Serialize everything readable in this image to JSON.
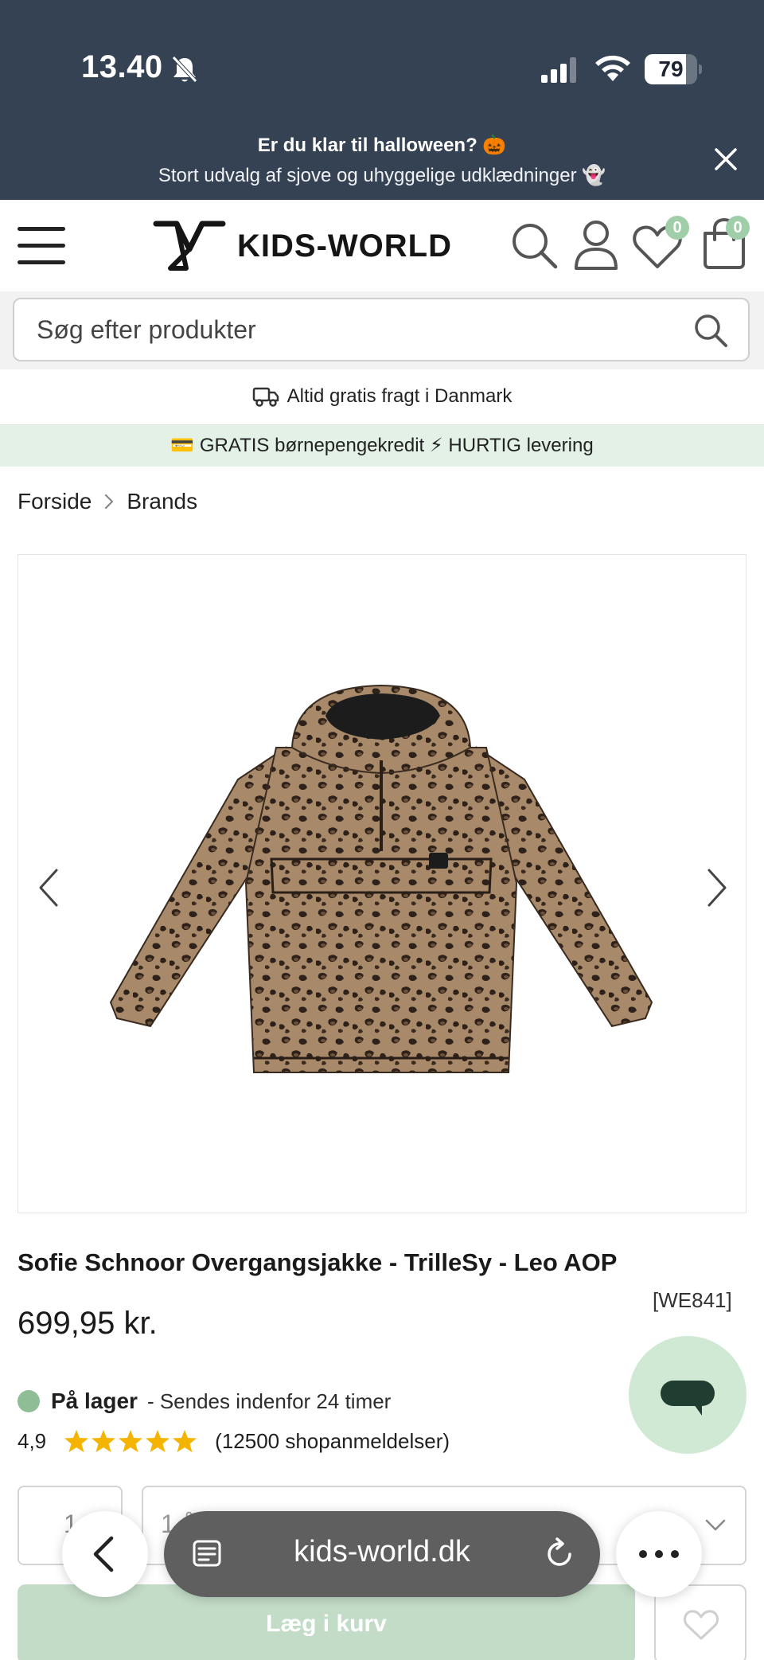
{
  "status_bar": {
    "time": "13.40",
    "battery": "79",
    "battery_level": 0.79
  },
  "announcement": {
    "title": "Er du klar til halloween? 🎃",
    "subtitle": "Stort udvalg af sjove og uhyggelige udklædninger 👻"
  },
  "header": {
    "logo_text": "KIDS-WORLD",
    "wishlist_count": "0",
    "cart_count": "0"
  },
  "search": {
    "placeholder": "Søg efter produkter"
  },
  "shipping_notice": "Altid gratis fragt i Danmark",
  "promo_bar": "💳 GRATIS børnepengekredit ⚡ HURTIG levering",
  "breadcrumb": [
    "Forside",
    "Brands"
  ],
  "product": {
    "title": "Sofie Schnoor Overgangsjakke - TrilleSy - Leo AOP",
    "sku": "[WE841]",
    "price": "699,95 kr.",
    "stock_label": "På lager",
    "stock_note": "- Sendes indenfor 24 timer",
    "rating": "4,9",
    "stars": 5,
    "reviews": "(12500 shopanmeldelser)",
    "quantity": "1",
    "size": "1 år / 80",
    "add_to_cart": "Læg i kurv"
  },
  "browser": {
    "url": "kids-world.dk"
  },
  "colors": {
    "topbar": "#344253",
    "accent_green": "#9fcea8",
    "promo_bg": "#e3f1e6",
    "star": "#f5b400",
    "chat_bg": "#cfe9d4",
    "chat_icon": "#1f3d30"
  }
}
